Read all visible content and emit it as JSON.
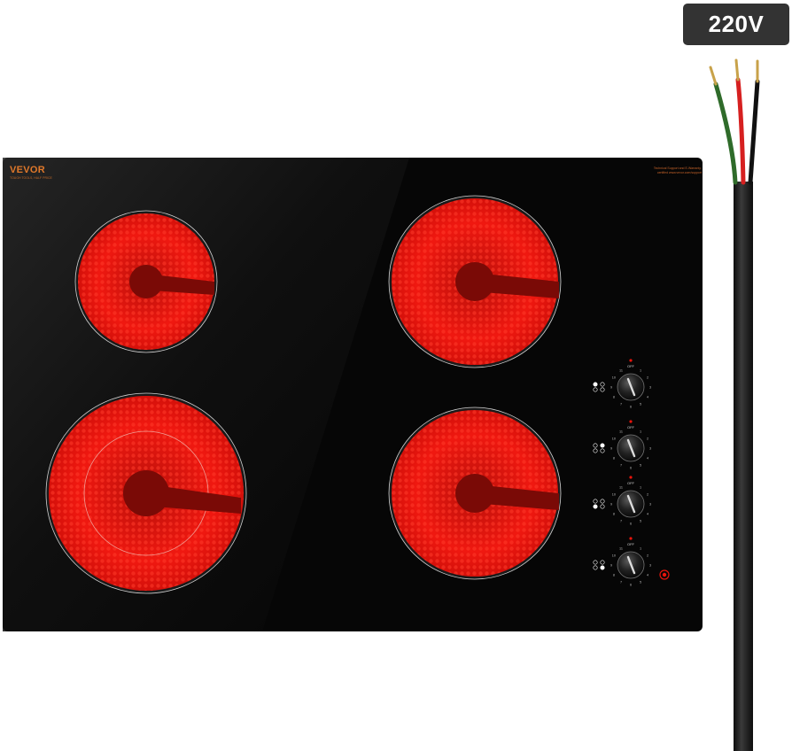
{
  "product": {
    "brand": "VEVOR",
    "brand_tagline": "TOUGH TOOLS, HALF PRICE",
    "support_note": "Technical Support and E-Warranty: certified www.vevor.com/support"
  },
  "power": {
    "voltage_label": "220V"
  },
  "knob_scale": {
    "off_label": "OFF",
    "marks": [
      "1",
      "2",
      "3",
      "4",
      "5",
      "6",
      "7",
      "8",
      "9",
      "10",
      "11"
    ]
  },
  "burners": [
    {
      "name": "rear-left",
      "glowing": true
    },
    {
      "name": "front-left",
      "glowing": true,
      "dual_zone": true
    },
    {
      "name": "rear-right",
      "glowing": true
    },
    {
      "name": "front-right",
      "glowing": true
    }
  ],
  "colors": {
    "glass": "#080808",
    "element_glow": "#e8140c",
    "brand_orange": "#e0782a",
    "cable": "#1a1a1a",
    "wire_green": "#2f6b2a",
    "wire_red": "#d62020",
    "wire_black": "#111111",
    "copper": "#c8a24a"
  }
}
